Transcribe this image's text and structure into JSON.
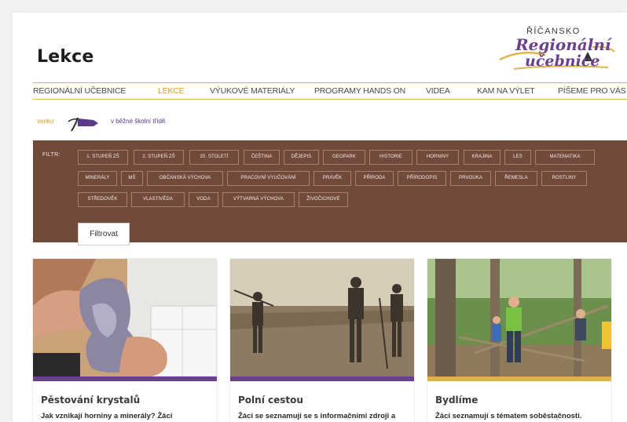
{
  "page": {
    "title": "Lekce"
  },
  "logo": {
    "line1": "ŘÍČANSKO",
    "line2": "Regionální",
    "line3": "učebnice"
  },
  "nav": {
    "items": [
      {
        "label": "REGIONÁLNÍ UČEBNICE",
        "active": false
      },
      {
        "label": "LEKCE",
        "active": true
      },
      {
        "label": "VÝUKOVÉ MATERIÁLY",
        "active": false
      },
      {
        "label": "PROGRAMY HANDS ON",
        "active": false
      },
      {
        "label": "VIDEA",
        "active": false
      },
      {
        "label": "KAM NA VÝLET",
        "active": false
      },
      {
        "label": "PÍŠEME PRO VÁS",
        "active": false
      }
    ]
  },
  "toggle": {
    "left_label": "venku",
    "right_label": "v běžné školní třídě"
  },
  "filter": {
    "label": "FILTR:",
    "tags": [
      "1. STUPEŇ ZŠ",
      "2. STUPEŇ ZŠ",
      "20. STOLETÍ",
      "ČEŠTINA",
      "DĚJEPIS",
      "GEOPARK",
      "HISTORIE",
      "HORNINY",
      "KRAJINA",
      "LES",
      "MATEMATIKA",
      "MINERÁLY",
      "MŠ",
      "OBČANSKÁ VÝCHOVA",
      "PRACOVNÍ VYUČOVÁNÍ",
      "PRAVĚK",
      "PŘÍRODA",
      "PŘÍRODOPIS",
      "PRVOUKA",
      "ŘEMESLA",
      "ROSTLINY",
      "STŘEDOVĚK",
      "VLASTIVĚDA",
      "VODA",
      "VÝTVARNÁ VÝCHOVA",
      "ŽIVOČICHOVÉ"
    ],
    "button_label": "Filtrovat"
  },
  "cards": [
    {
      "title": "Pěstování krystalů",
      "text": "Jak vznikají horniny a minerály? Žáci",
      "image": "crystal-photo"
    },
    {
      "title": "Polní cestou",
      "text": "Žáci se seznamují se s informačními zdroji a",
      "image": "historic-field-photo"
    },
    {
      "title": "Bydlíme",
      "text": "Žáci seznamují s tématem soběstačnosti.",
      "image": "children-forest-photo"
    }
  ],
  "colors": {
    "accent_gold": "#e1b24b",
    "active_nav": "#d99a2b",
    "filter_bg": "#714a3c",
    "brand_purple": "#5b3a8c"
  }
}
